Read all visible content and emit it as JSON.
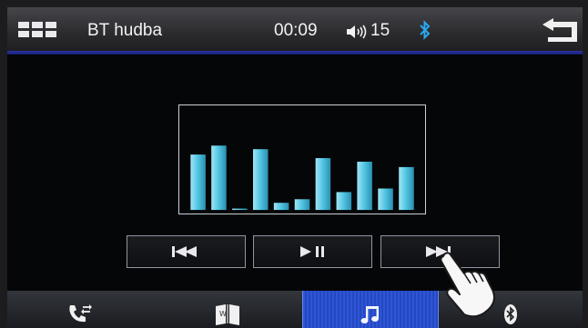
{
  "status_bar": {
    "title": "BT hudba",
    "time": "00:09",
    "volume": "15",
    "icons": [
      "menu-icon",
      "volume-icon",
      "bluetooth-icon",
      "back-arrow-icon"
    ]
  },
  "equalizer": {
    "bar_color": "#4fc3e0",
    "levels": [
      0.62,
      0.72,
      0.01,
      0.68,
      0.08,
      0.12,
      0.58,
      0.2,
      0.54,
      0.24,
      0.48
    ]
  },
  "controls": {
    "buttons": [
      "previous-track",
      "play-pause",
      "next-track"
    ]
  },
  "tabs": {
    "items": [
      "phone",
      "contacts-book",
      "music",
      "bluetooth"
    ],
    "active": "music"
  },
  "colors": {
    "accent_blue": "#2e56d6",
    "divider_blue": "#2a34a8",
    "bluetooth_status": "#29a9f0"
  }
}
